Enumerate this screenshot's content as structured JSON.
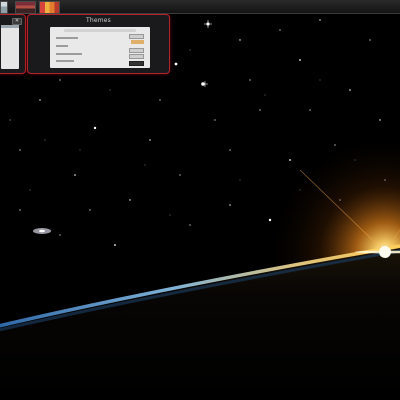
{
  "taskbar": {
    "items": [
      {
        "name": "window-icon"
      },
      {
        "name": "image-viewer-icon"
      },
      {
        "name": "chart-icon"
      }
    ]
  },
  "switcher": {
    "thumbnails": [
      {
        "title": ""
      },
      {
        "title": "Themes"
      }
    ],
    "close_glyph": "✕"
  },
  "colors": {
    "accent": "#b3242c",
    "space": "#000000",
    "sun": "#ffe9a8",
    "atmosphere_blue": "#3f8fd8"
  }
}
